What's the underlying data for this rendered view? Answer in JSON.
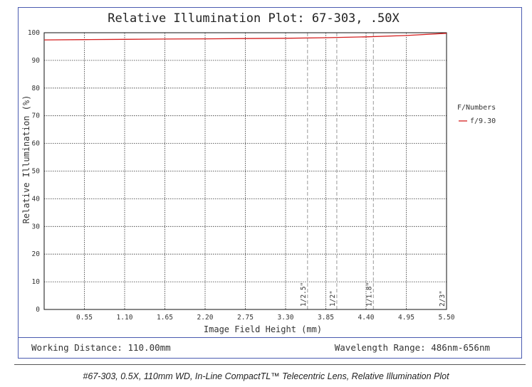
{
  "chart_data": {
    "type": "line",
    "title": "Relative Illumination Plot: 67-303, .50X",
    "xlabel": "Image Field Height (mm)",
    "ylabel": "Relative Illumination (%)",
    "xlim": [
      0,
      5.5
    ],
    "ylim": [
      0,
      100
    ],
    "x_ticks": [
      "0.55",
      "1.10",
      "1.65",
      "2.20",
      "2.75",
      "3.30",
      "3.85",
      "4.40",
      "4.95",
      "5.50"
    ],
    "y_ticks": [
      "0",
      "10",
      "20",
      "30",
      "40",
      "50",
      "60",
      "70",
      "80",
      "90",
      "100"
    ],
    "grid": true,
    "legend_title": "F/Numbers",
    "legend_position": "right",
    "series": [
      {
        "name": "f/9.30",
        "color": "#d42020",
        "x": [
          0,
          0.55,
          1.1,
          1.65,
          2.2,
          2.75,
          3.3,
          3.85,
          4.4,
          4.95,
          5.5
        ],
        "y": [
          97.4,
          97.5,
          97.6,
          97.7,
          97.8,
          97.9,
          98.0,
          98.2,
          98.5,
          99.0,
          99.8
        ]
      }
    ],
    "sensor_markers": [
      {
        "label": "1/2.5\"",
        "x": 3.6
      },
      {
        "label": "1/2\"",
        "x": 4.0
      },
      {
        "label": "1/1.8\"",
        "x": 4.5
      },
      {
        "label": "2/3\"",
        "x": 5.5
      }
    ]
  },
  "footer": {
    "working_distance": "Working Distance: 110.00mm",
    "wavelength_range": "Wavelength Range: 486nm-656nm"
  },
  "caption": "#67-303, 0.5X, 110mm WD, In-Line CompactTL™ Telecentric Lens, Relative Illumination Plot",
  "colors": {
    "frame": "#4a5bb0",
    "series": "#d42020",
    "marker": "#999999"
  }
}
